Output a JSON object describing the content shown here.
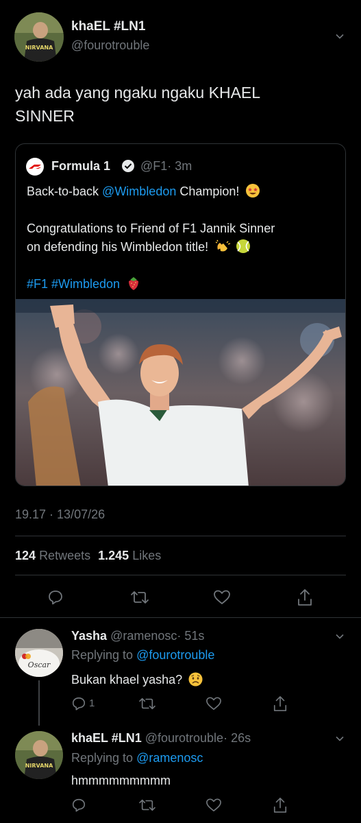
{
  "tweet": {
    "author_name": "khaEL #LN1",
    "author_handle": "@fourotrouble",
    "avatar_text": "NIRVANA",
    "text_line1": "yah ada yang ngaku ngaku KHAEL",
    "text_line2": "SINNER",
    "timestamp": "19.17 · 13/07/26",
    "retweets_count": "124",
    "retweets_label": "Retweets",
    "likes_count": "1.245",
    "likes_label": "Likes"
  },
  "quote": {
    "author_name": "Formula 1",
    "handle": "@F1",
    "time": "· 3m",
    "line1_a": "Back-to-back ",
    "line1_mention": "@Wimbledon",
    "line1_b": " Champion!",
    "line2": "Congratulations to Friend of F1 Jannik Sinner",
    "line3": "on defending his Wimbledon title!",
    "hashtags": "#F1 #Wimbledon"
  },
  "replies": [
    {
      "author_name": "Yasha",
      "handle": "@ramenosc",
      "time": "· 51s",
      "replying_label": "Replying to",
      "replying_to": "@fourotrouble",
      "text": "Bukan khael yasha?",
      "reply_count": "1",
      "avatar_text": "Oscar"
    },
    {
      "author_name": "khaEL #LN1",
      "handle": "@fourotrouble",
      "time": "· 26s",
      "replying_label": "Replying to",
      "replying_to": "@ramenosc",
      "text": "hmmmmmmmmm",
      "avatar_text": "NIRVANA"
    }
  ],
  "colors": {
    "background": "#000000",
    "accent": "#1d9bf0",
    "muted": "#71767b",
    "divider": "#2f3336"
  },
  "icons": [
    "chevron-down-icon",
    "reply-icon",
    "retweet-icon",
    "like-icon",
    "share-icon",
    "verified-icon",
    "f1-logo-icon"
  ]
}
